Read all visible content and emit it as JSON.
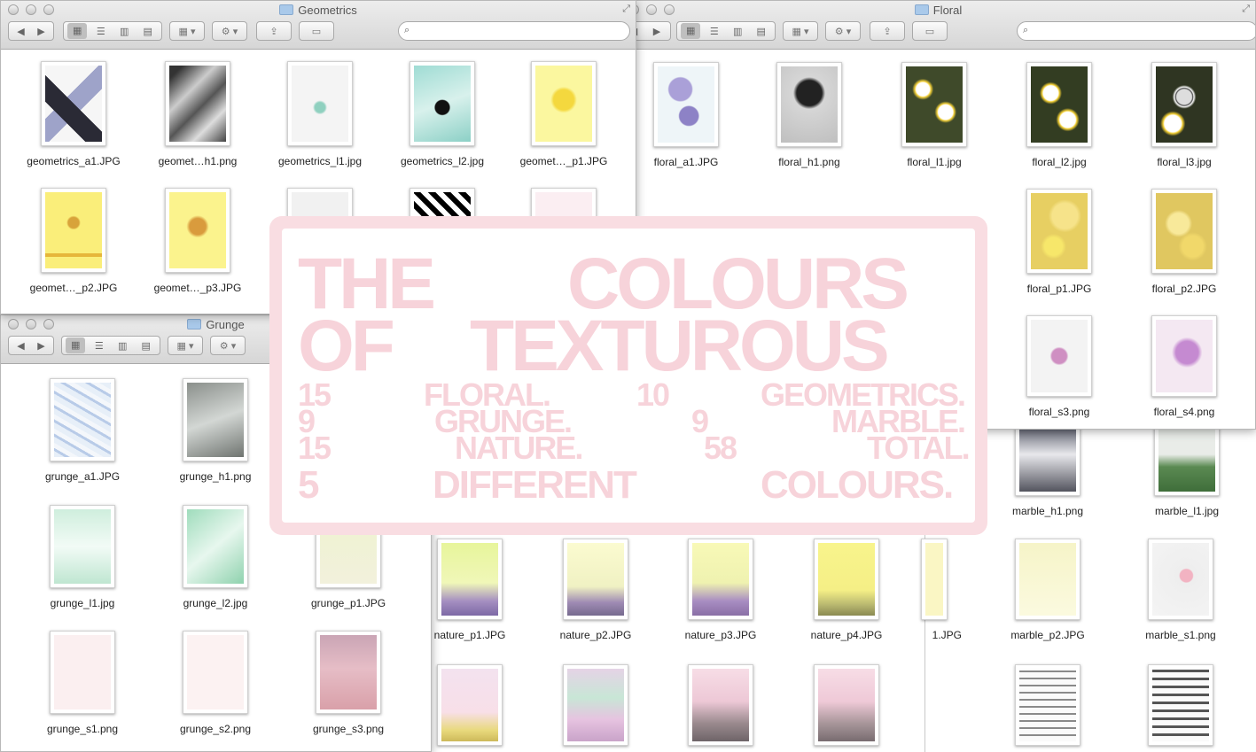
{
  "windows": {
    "floral": {
      "title": "Floral",
      "items": [
        {
          "label": "floral_a1.JPG"
        },
        {
          "label": "floral_h1.png"
        },
        {
          "label": "floral_l1.jpg"
        },
        {
          "label": "floral_l2.jpg"
        },
        {
          "label": "floral_l3.jpg"
        },
        {
          "label": "floral_p1.JPG"
        },
        {
          "label": "floral_p2.JPG"
        },
        {
          "label": "floral_s3.png"
        },
        {
          "label": "floral_s4.png"
        }
      ]
    },
    "geometrics": {
      "title": "Geometrics",
      "items": [
        {
          "label": "geometrics_a1.JPG"
        },
        {
          "label": "geomet…h1.png"
        },
        {
          "label": "geometrics_l1.jpg"
        },
        {
          "label": "geometrics_l2.jpg"
        },
        {
          "label": "geomet…_p1.JPG"
        },
        {
          "label": "geomet…_p2.JPG"
        },
        {
          "label": "geomet…_p3.JPG"
        }
      ]
    },
    "grunge": {
      "title": "Grunge",
      "items": [
        {
          "label": "grunge_a1.JPG"
        },
        {
          "label": "grunge_h1.png"
        },
        {
          "label": "grunge_l1.jpg"
        },
        {
          "label": "grunge_l2.jpg"
        },
        {
          "label": "grunge_p1.JPG"
        },
        {
          "label": "grunge_s1.png"
        },
        {
          "label": "grunge_s2.png"
        },
        {
          "label": "grunge_s3.png"
        }
      ]
    },
    "nature": {
      "items": [
        {
          "label": "nature_p1.JPG"
        },
        {
          "label": "nature_p2.JPG"
        },
        {
          "label": "nature_p3.JPG"
        },
        {
          "label": "nature_p4.JPG"
        }
      ],
      "partial_label": "1.JPG"
    },
    "marble": {
      "items": [
        {
          "label": "marble_h1.png"
        },
        {
          "label": "marble_l1.jpg"
        },
        {
          "label": "marble_p2.JPG"
        },
        {
          "label": "marble_s1.png"
        }
      ]
    }
  },
  "overlay": {
    "title_line1_a": "THE",
    "title_line1_b": "COLOURS",
    "title_line2_a": "OF",
    "title_line2_b": "TEXTUROUS",
    "rows": [
      {
        "n1": "15",
        "c1": "FLORAL.",
        "n2": "10",
        "c2": "GEOMETRICS."
      },
      {
        "n1": "9",
        "c1": "GRUNGE.",
        "n2": "9",
        "c2": "MARBLE."
      },
      {
        "n1": "15",
        "c1": "NATURE.",
        "n2": "58",
        "c2": "TOTAL."
      }
    ],
    "last_row": {
      "n": "5",
      "w1": "DIFFERENT",
      "w2": "COLOURS."
    }
  },
  "icons": {
    "back": "◀",
    "forward": "▶",
    "gear": "⚙",
    "share": "⇪",
    "search": "⌕",
    "fullscreen": "⤢"
  },
  "colors": {
    "overlay_pink": "#f7d3da",
    "overlay_border": "#f9dde2"
  }
}
